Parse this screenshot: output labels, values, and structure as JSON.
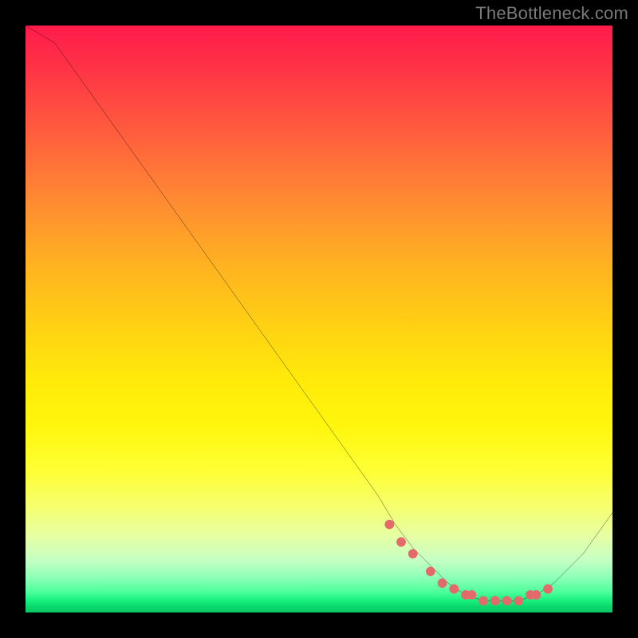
{
  "watermark": "TheBottleneck.com",
  "chart_data": {
    "type": "line",
    "title": "",
    "xlabel": "",
    "ylabel": "",
    "xlim": [
      0,
      100
    ],
    "ylim": [
      0,
      100
    ],
    "grid": false,
    "legend": false,
    "x": [
      0,
      5,
      10,
      15,
      20,
      25,
      30,
      35,
      40,
      45,
      50,
      55,
      60,
      63,
      66,
      69,
      72,
      75,
      78,
      81,
      84,
      87,
      90,
      95,
      100
    ],
    "y": [
      100,
      97,
      90,
      83,
      76,
      69,
      62,
      55,
      48,
      41,
      34,
      27,
      20,
      15,
      11,
      8,
      5,
      3,
      2,
      2,
      2,
      3,
      5,
      10,
      17
    ],
    "markers": {
      "x": [
        62,
        64,
        66,
        69,
        71,
        73,
        75,
        76,
        78,
        80,
        82,
        84,
        86,
        87,
        89
      ],
      "y": [
        15,
        12,
        10,
        7,
        5,
        4,
        3,
        3,
        2,
        2,
        2,
        2,
        3,
        3,
        4
      ]
    },
    "colors": {
      "line": "#000000",
      "marker": "#e46a6a",
      "gradient_top": "#ff1b4b",
      "gradient_bottom": "#07c763"
    }
  }
}
